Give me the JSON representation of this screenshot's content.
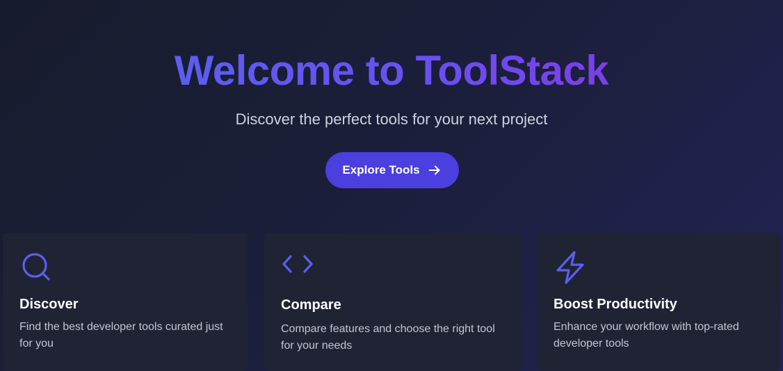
{
  "hero": {
    "title": "Welcome to ToolStack",
    "subtitle": "Discover the perfect tools for your next project",
    "cta_label": "Explore Tools",
    "cta_icon": "arrow-right-icon"
  },
  "features": [
    {
      "icon": "search-icon",
      "title": "Discover",
      "description": "Find the best developer tools curated just for you"
    },
    {
      "icon": "code-icon",
      "title": "Compare",
      "description": "Compare features and choose the right tool for your needs"
    },
    {
      "icon": "lightning-icon",
      "title": "Boost Productivity",
      "description": "Enhance your workflow with top-rated developer tools"
    }
  ],
  "colors": {
    "accent": "#4b3fe0",
    "title_gradient_start": "#5b5ef0",
    "title_gradient_end": "#7b3fe6",
    "card_background": "#1f2333",
    "icon_color": "#5b5ef0"
  }
}
